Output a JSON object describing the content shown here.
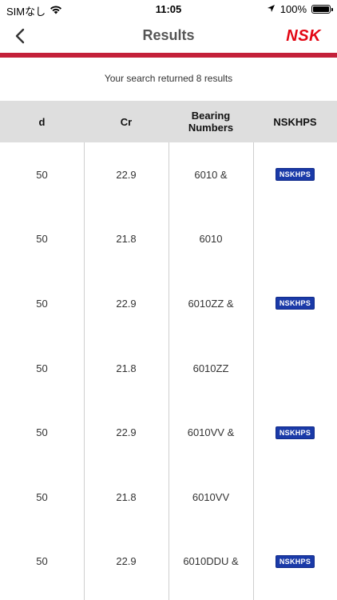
{
  "status": {
    "carrier": "SIMなし",
    "time": "11:05",
    "battery": "100%"
  },
  "nav": {
    "title": "Results",
    "logo": "NSK"
  },
  "summary": "Your search returned 8 results",
  "table": {
    "headers": [
      "d",
      "Cr",
      "Bearing Numbers",
      "NSKHPS"
    ],
    "rows": [
      {
        "d": "50",
        "cr": "22.9",
        "bearing": "6010 &",
        "badge": "NSKHPS"
      },
      {
        "d": "50",
        "cr": "21.8",
        "bearing": "6010",
        "badge": ""
      },
      {
        "d": "50",
        "cr": "22.9",
        "bearing": "6010ZZ &",
        "badge": "NSKHPS"
      },
      {
        "d": "50",
        "cr": "21.8",
        "bearing": "6010ZZ",
        "badge": ""
      },
      {
        "d": "50",
        "cr": "22.9",
        "bearing": "6010VV &",
        "badge": "NSKHPS"
      },
      {
        "d": "50",
        "cr": "21.8",
        "bearing": "6010VV",
        "badge": ""
      },
      {
        "d": "50",
        "cr": "22.9",
        "bearing": "6010DDU &",
        "badge": "NSKHPS"
      }
    ]
  },
  "colors": {
    "brand_red": "#e30613",
    "rule_red": "#c4203a",
    "badge_blue": "#1a3aa8",
    "header_gray": "#dedede"
  }
}
